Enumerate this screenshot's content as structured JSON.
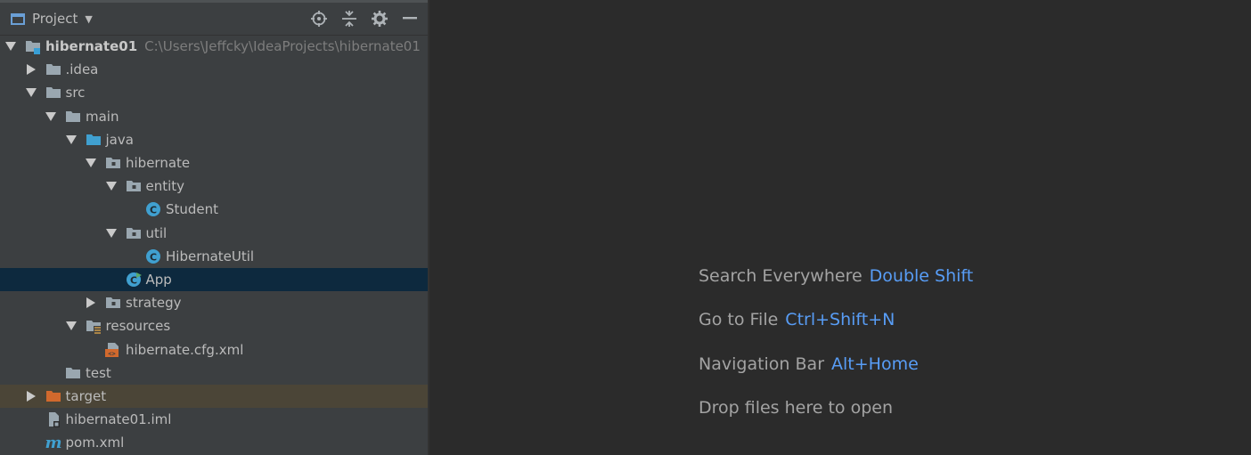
{
  "panel": {
    "title": "Project"
  },
  "tree": [
    {
      "label": "hibernate01",
      "path": "C:\\Users\\Jeffcky\\IdeaProjects\\hibernate01",
      "depth": 0,
      "arrow": "down",
      "icon": "module"
    },
    {
      "label": ".idea",
      "depth": 1,
      "arrow": "right",
      "icon": "folder"
    },
    {
      "label": "src",
      "depth": 1,
      "arrow": "down",
      "icon": "folder"
    },
    {
      "label": "main",
      "depth": 2,
      "arrow": "down",
      "icon": "folder"
    },
    {
      "label": "java",
      "depth": 3,
      "arrow": "down",
      "icon": "source-folder"
    },
    {
      "label": "hibernate",
      "depth": 4,
      "arrow": "down",
      "icon": "package"
    },
    {
      "label": "entity",
      "depth": 5,
      "arrow": "down",
      "icon": "package"
    },
    {
      "label": "Student",
      "depth": 6,
      "arrow": "",
      "icon": "class"
    },
    {
      "label": "util",
      "depth": 5,
      "arrow": "down",
      "icon": "package"
    },
    {
      "label": "HibernateUtil",
      "depth": 6,
      "arrow": "",
      "icon": "class"
    },
    {
      "label": "App",
      "depth": 5,
      "arrow": "",
      "icon": "class-main",
      "selected": true
    },
    {
      "label": "strategy",
      "depth": 4,
      "arrow": "right",
      "icon": "package"
    },
    {
      "label": "resources",
      "depth": 3,
      "arrow": "down",
      "icon": "resources-folder"
    },
    {
      "label": "hibernate.cfg.xml",
      "depth": 4,
      "arrow": "",
      "icon": "xml"
    },
    {
      "label": "test",
      "depth": 2,
      "arrow": "",
      "icon": "folder"
    },
    {
      "label": "target",
      "depth": 1,
      "arrow": "right",
      "icon": "excluded-folder",
      "excluded": true
    },
    {
      "label": "hibernate01.iml",
      "depth": 1,
      "arrow": "",
      "icon": "iml"
    },
    {
      "label": "pom.xml",
      "depth": 1,
      "arrow": "",
      "icon": "maven"
    }
  ],
  "hints": [
    {
      "label": "Search Everywhere",
      "key": "Double Shift"
    },
    {
      "label": "Go to File",
      "key": "Ctrl+Shift+N"
    },
    {
      "label": "Navigation Bar",
      "key": "Alt+Home"
    },
    {
      "label": "Drop files here to open",
      "key": ""
    }
  ],
  "colors": {
    "panel_bg": "#3c3f41",
    "editor_bg": "#2b2b2b",
    "selected_row": "#0d293e",
    "excluded_row": "#4b4537",
    "shortcut_key": "#589df6"
  }
}
